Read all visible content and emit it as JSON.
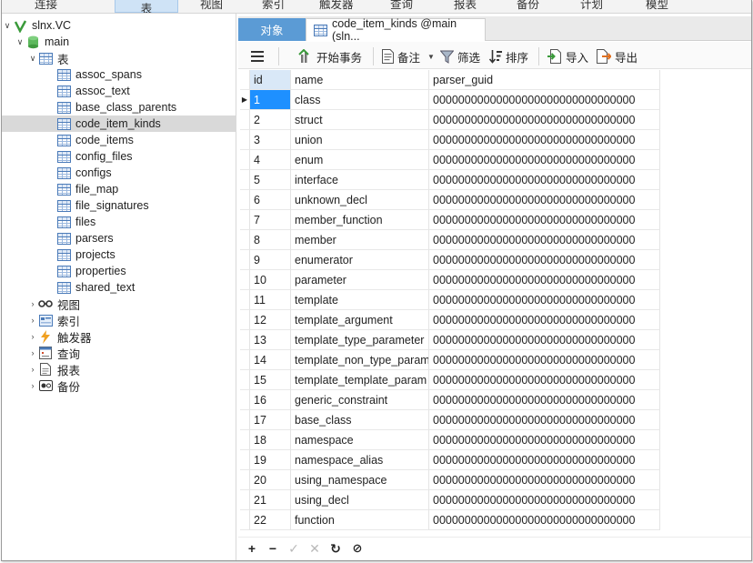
{
  "menubar": {
    "items": [
      "连接",
      "表",
      "视图",
      "索引",
      "触发器",
      "查询",
      "报表",
      "备份",
      "计划",
      "模型"
    ]
  },
  "navigator": {
    "connection": "slnx.VC",
    "database": "main",
    "tables_group": "表",
    "tables": [
      "assoc_spans",
      "assoc_text",
      "base_class_parents",
      "code_item_kinds",
      "code_items",
      "config_files",
      "configs",
      "file_map",
      "file_signatures",
      "files",
      "parsers",
      "projects",
      "properties",
      "shared_text"
    ],
    "selected_table": "code_item_kinds",
    "groups": [
      {
        "label": "视图",
        "icon": "glasses-icon"
      },
      {
        "label": "索引",
        "icon": "index-icon"
      },
      {
        "label": "触发器",
        "icon": "lightning-icon"
      },
      {
        "label": "查询",
        "icon": "query-icon"
      },
      {
        "label": "报表",
        "icon": "report-icon"
      },
      {
        "label": "备份",
        "icon": "backup-icon"
      }
    ]
  },
  "tabs": {
    "objects": "对象",
    "document": "code_item_kinds @main (sln..."
  },
  "toolbar": {
    "menu_icon": "hamburger-icon",
    "begin_transaction": "开始事务",
    "memo": "备注",
    "filter": "筛选",
    "sort": "排序",
    "import": "导入",
    "export": "导出"
  },
  "grid": {
    "columns": [
      "id",
      "name",
      "parser_guid"
    ],
    "rows": [
      [
        "1",
        "class",
        "00000000000000000000000000000000"
      ],
      [
        "2",
        "struct",
        "00000000000000000000000000000000"
      ],
      [
        "3",
        "union",
        "00000000000000000000000000000000"
      ],
      [
        "4",
        "enum",
        "00000000000000000000000000000000"
      ],
      [
        "5",
        "interface",
        "00000000000000000000000000000000"
      ],
      [
        "6",
        "unknown_decl",
        "00000000000000000000000000000000"
      ],
      [
        "7",
        "member_function",
        "00000000000000000000000000000000"
      ],
      [
        "8",
        "member",
        "00000000000000000000000000000000"
      ],
      [
        "9",
        "enumerator",
        "00000000000000000000000000000000"
      ],
      [
        "10",
        "parameter",
        "00000000000000000000000000000000"
      ],
      [
        "11",
        "template",
        "00000000000000000000000000000000"
      ],
      [
        "12",
        "template_argument",
        "00000000000000000000000000000000"
      ],
      [
        "13",
        "template_type_parameter",
        "00000000000000000000000000000000"
      ],
      [
        "14",
        "template_non_type_param",
        "00000000000000000000000000000000"
      ],
      [
        "15",
        "template_template_param",
        "00000000000000000000000000000000"
      ],
      [
        "16",
        "generic_constraint",
        "00000000000000000000000000000000"
      ],
      [
        "17",
        "base_class",
        "00000000000000000000000000000000"
      ],
      [
        "18",
        "namespace",
        "00000000000000000000000000000000"
      ],
      [
        "19",
        "namespace_alias",
        "00000000000000000000000000000000"
      ],
      [
        "20",
        "using_namespace",
        "00000000000000000000000000000000"
      ],
      [
        "21",
        "using_decl",
        "00000000000000000000000000000000"
      ],
      [
        "22",
        "function",
        "00000000000000000000000000000000"
      ]
    ],
    "current_row_marker": "▶"
  },
  "bottombar": {
    "add": "+",
    "remove": "−",
    "apply": "✓",
    "discard": "✕",
    "refresh": "↻",
    "stop": "⊘"
  },
  "colors": {
    "tab_active": "#5b9bd5",
    "selection": "#1e90ff",
    "tree_selected": "#d9d9d9"
  }
}
